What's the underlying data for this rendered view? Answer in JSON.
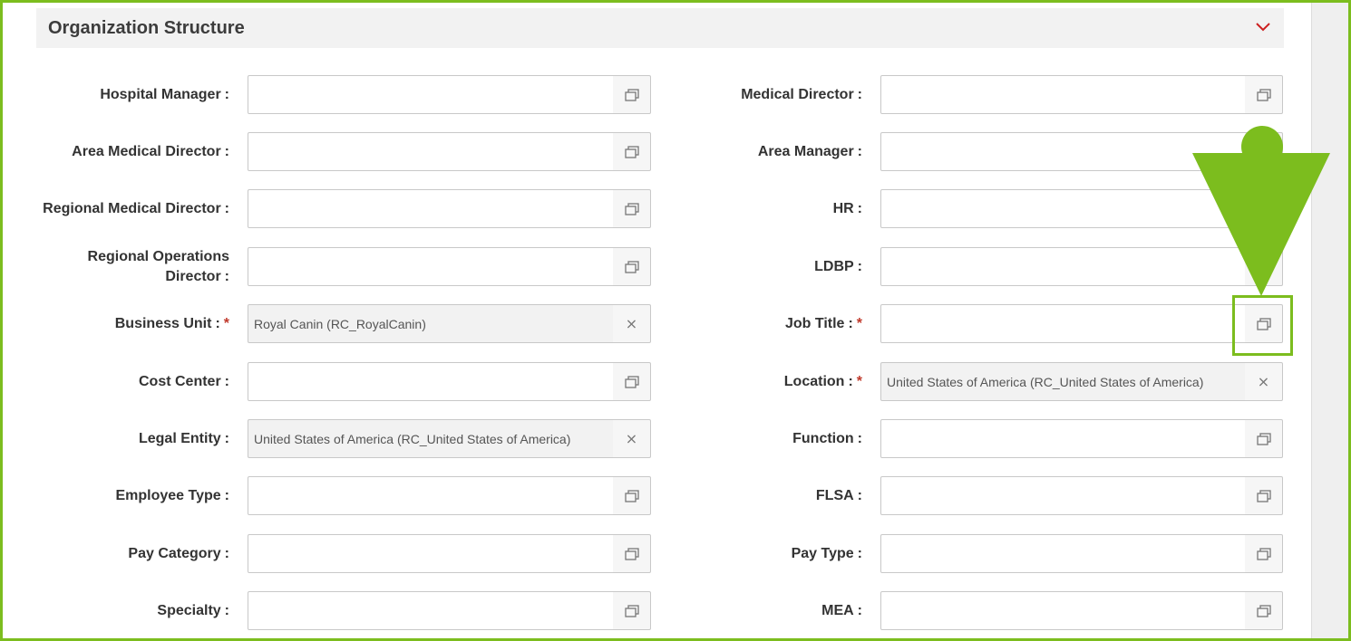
{
  "section": {
    "title": "Organization Structure",
    "collapse_icon": "chevron-down-icon",
    "accent_color": "#cc1f1f"
  },
  "fields_left": [
    {
      "id": "hospital-manager",
      "label": "Hospital Manager",
      "separator": ":",
      "required": false,
      "value": "",
      "button": "lookup-icon"
    },
    {
      "id": "area-medical-director",
      "label": "Area Medical Director",
      "separator": ":",
      "required": false,
      "value": "",
      "button": "lookup-icon"
    },
    {
      "id": "regional-medical-director",
      "label": "Regional Medical Director",
      "separator": ":",
      "required": false,
      "value": "",
      "button": "lookup-icon"
    },
    {
      "id": "regional-operations-director",
      "label": "Regional Operations Director",
      "separator": ":",
      "required": false,
      "value": "",
      "button": "lookup-icon"
    },
    {
      "id": "business-unit",
      "label": "Business Unit",
      "separator": ":",
      "required": true,
      "required_mark": "*",
      "value": "Royal Canin (RC_RoyalCanin)",
      "button": "clear-icon"
    },
    {
      "id": "cost-center",
      "label": "Cost Center",
      "separator": ":",
      "required": false,
      "value": "",
      "button": "lookup-icon"
    },
    {
      "id": "legal-entity",
      "label": "Legal Entity",
      "separator": ":",
      "required": false,
      "value": "United States of America (RC_United States of America)",
      "button": "clear-icon"
    },
    {
      "id": "employee-type",
      "label": "Employee Type",
      "separator": ":",
      "required": false,
      "value": "",
      "button": "lookup-icon"
    },
    {
      "id": "pay-category",
      "label": "Pay Category",
      "separator": ":",
      "required": false,
      "value": "",
      "button": "lookup-icon"
    },
    {
      "id": "specialty",
      "label": "Specialty",
      "separator": ":",
      "required": false,
      "value": "",
      "button": "lookup-icon"
    }
  ],
  "fields_right": [
    {
      "id": "medical-director",
      "label": "Medical Director",
      "separator": ":",
      "required": false,
      "value": "",
      "button": "lookup-icon"
    },
    {
      "id": "area-manager",
      "label": "Area Manager",
      "separator": ":",
      "required": false,
      "value": "",
      "button": "lookup-icon"
    },
    {
      "id": "hr",
      "label": "HR",
      "separator": ":",
      "required": false,
      "value": "",
      "button": "lookup-icon"
    },
    {
      "id": "ldbp",
      "label": "LDBP",
      "separator": ":",
      "required": false,
      "value": "",
      "button": "lookup-icon"
    },
    {
      "id": "job-title",
      "label": "Job Title",
      "separator": ":",
      "required": true,
      "required_mark": "*",
      "value": "",
      "button": "lookup-icon"
    },
    {
      "id": "location",
      "label": "Location",
      "separator": ":",
      "required": true,
      "required_mark": "*",
      "value": "United States of America (RC_United States of America)",
      "button": "clear-icon"
    },
    {
      "id": "function",
      "label": "Function",
      "separator": ":",
      "required": false,
      "value": "",
      "button": "lookup-icon"
    },
    {
      "id": "flsa",
      "label": "FLSA",
      "separator": ":",
      "required": false,
      "value": "",
      "button": "lookup-icon"
    },
    {
      "id": "pay-type",
      "label": "Pay Type",
      "separator": ":",
      "required": false,
      "value": "",
      "button": "lookup-icon"
    },
    {
      "id": "mea",
      "label": "MEA",
      "separator": ":",
      "required": false,
      "value": "",
      "button": "lookup-icon"
    }
  ],
  "clear_glyph": "×",
  "annotation": {
    "color": "#7cbd1e",
    "arrow_icon": "down-arrow-pointer-icon",
    "highlight_target": "job-title-lookup-button"
  }
}
